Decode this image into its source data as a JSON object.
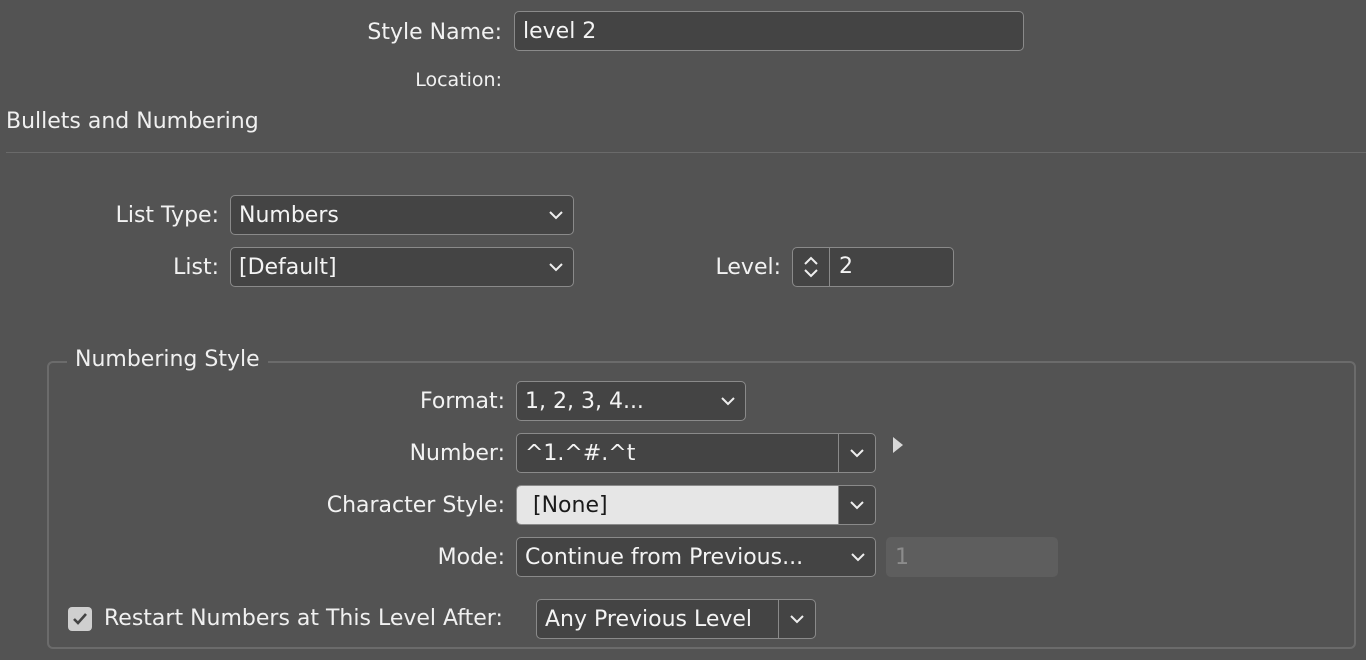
{
  "header": {
    "style_name_label": "Style Name:",
    "style_name_value": "level 2",
    "location_label": "Location:"
  },
  "section": {
    "title": "Bullets and Numbering"
  },
  "list_settings": {
    "list_type_label": "List Type:",
    "list_type_value": "Numbers",
    "list_label": "List:",
    "list_value": "[Default]",
    "level_label": "Level:",
    "level_value": "2"
  },
  "numbering_style": {
    "title": "Numbering Style",
    "format_label": "Format:",
    "format_value": "1, 2, 3, 4...",
    "number_label": "Number:",
    "number_value": "^1.^#.^t",
    "character_style_label": "Character Style:",
    "character_style_value": "[None]",
    "mode_label": "Mode:",
    "mode_value": "Continue from Previous...",
    "mode_start_value": "1",
    "restart_label": "Restart Numbers at This Level After:",
    "restart_checked": true,
    "restart_value": "Any Previous Level"
  },
  "icons": {
    "dropdown": "chevron-down-icon",
    "stepper": "stepper-icon",
    "flyout": "triangle-right-icon",
    "check": "checkmark-icon"
  },
  "colors": {
    "background": "#535353",
    "field": "#444444",
    "field_light": "#e6e6e6",
    "disabled_field": "#5e5e5e",
    "border": "#8a8a8a"
  }
}
